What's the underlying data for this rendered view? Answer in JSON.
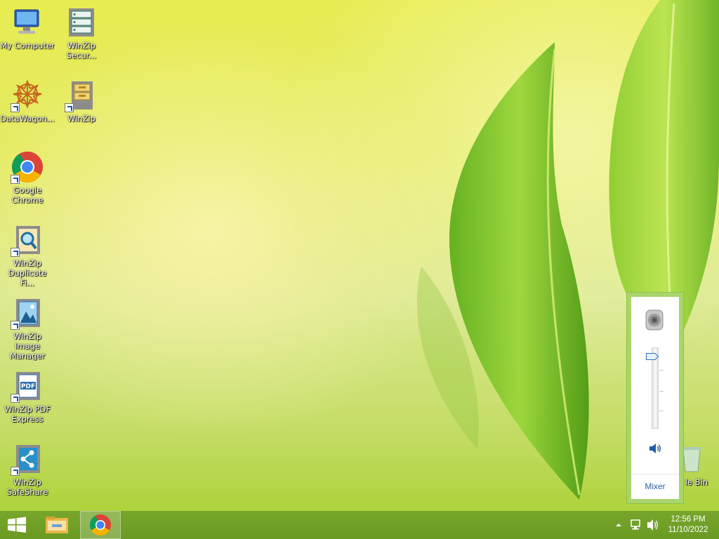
{
  "desktop": {
    "icons": [
      {
        "label": "My Computer",
        "icon": "computer-icon"
      },
      {
        "label": "WinZip\nSecur...",
        "icon": "winzip-secure-backup-icon"
      },
      {
        "label": "DataWagon...",
        "icon": "datawagon-icon"
      },
      {
        "label": "WinZip",
        "icon": "winzip-icon"
      },
      {
        "label": "Google\nChrome",
        "icon": "chrome-icon"
      },
      {
        "label": "WinZip\nDuplicate Fi...",
        "icon": "winzip-duplicate-finder-icon"
      },
      {
        "label": "WinZip Image\nManager",
        "icon": "winzip-image-manager-icon"
      },
      {
        "label": "WinZip PDF\nExpress",
        "icon": "winzip-pdf-express-icon"
      },
      {
        "label": "WinZip\nSafeShare",
        "icon": "winzip-safeshare-icon"
      },
      {
        "label": "le Bin",
        "icon": "recycle-bin-icon"
      }
    ]
  },
  "volume_flyout": {
    "level_fraction": 0.9,
    "mixer_label": "Mixer"
  },
  "taskbar": {
    "start_icon": "windows-logo-icon",
    "pinned": [
      "file-explorer-icon",
      "chrome-icon"
    ],
    "tray": [
      "show-hidden-icons-icon",
      "network-icon",
      "speaker-icon"
    ],
    "clock_time": "12:56 PM",
    "clock_date": "11/10/2022"
  },
  "colors": {
    "taskbar": "#6b9a23",
    "flyout_border": "#a9d66b",
    "link": "#2a5fa8"
  }
}
